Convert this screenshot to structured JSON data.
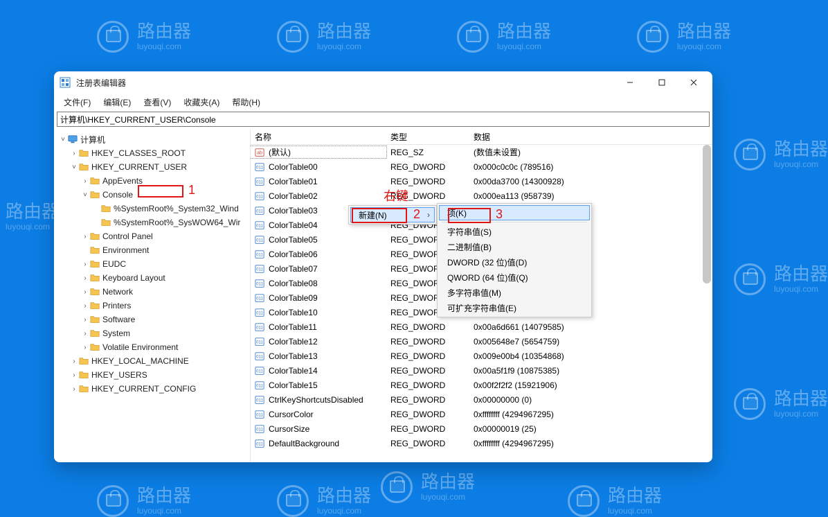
{
  "watermark": {
    "main": "路由器",
    "sub": "luyouqi.com"
  },
  "window": {
    "title": "注册表编辑器",
    "address": "计算机\\HKEY_CURRENT_USER\\Console"
  },
  "menu": {
    "file": "文件(F)",
    "edit": "编辑(E)",
    "view": "查看(V)",
    "favorites": "收藏夹(A)",
    "help": "帮助(H)"
  },
  "tree": {
    "root": "计算机",
    "hkcr": "HKEY_CLASSES_ROOT",
    "hkcu": "HKEY_CURRENT_USER",
    "appevents": "AppEvents",
    "console": "Console",
    "consolechild1": "%SystemRoot%_System32_Wind",
    "consolechild2": "%SystemRoot%_SysWOW64_Wir",
    "controlpanel": "Control Panel",
    "environment": "Environment",
    "eudc": "EUDC",
    "keyboard": "Keyboard Layout",
    "network": "Network",
    "printers": "Printers",
    "software": "Software",
    "system": "System",
    "volatile": "Volatile Environment",
    "hklm": "HKEY_LOCAL_MACHINE",
    "hku": "HKEY_USERS",
    "hkcc": "HKEY_CURRENT_CONFIG"
  },
  "columns": {
    "name": "名称",
    "type": "类型",
    "data": "数据"
  },
  "values": [
    {
      "icon": "str",
      "name": "(默认)",
      "type": "REG_SZ",
      "data": "(数值未设置)"
    },
    {
      "icon": "bin",
      "name": "ColorTable00",
      "type": "REG_DWORD",
      "data": "0x000c0c0c (789516)"
    },
    {
      "icon": "bin",
      "name": "ColorTable01",
      "type": "REG_DWORD",
      "data": "0x00da3700 (14300928)"
    },
    {
      "icon": "bin",
      "name": "ColorTable02",
      "type": "REG_DWORD",
      "data": "0x000ea113 (958739)"
    },
    {
      "icon": "bin",
      "name": "ColorTable03",
      "type": "REG_DWORD",
      "data": ""
    },
    {
      "icon": "bin",
      "name": "ColorTable04",
      "type": "REG_DWORD",
      "data": ""
    },
    {
      "icon": "bin",
      "name": "ColorTable05",
      "type": "REG_DWORD",
      "data": ""
    },
    {
      "icon": "bin",
      "name": "ColorTable06",
      "type": "REG_DWORD",
      "data": ""
    },
    {
      "icon": "bin",
      "name": "ColorTable07",
      "type": "REG_DWORD",
      "data": ""
    },
    {
      "icon": "bin",
      "name": "ColorTable08",
      "type": "REG_DWORD",
      "data": ""
    },
    {
      "icon": "bin",
      "name": "ColorTable09",
      "type": "REG_DWORD",
      "data": ""
    },
    {
      "icon": "bin",
      "name": "ColorTable10",
      "type": "REG_DWORD",
      "data": ""
    },
    {
      "icon": "bin",
      "name": "ColorTable11",
      "type": "REG_DWORD",
      "data": "0x00a6d661 (14079585)"
    },
    {
      "icon": "bin",
      "name": "ColorTable12",
      "type": "REG_DWORD",
      "data": "0x005648e7 (5654759)"
    },
    {
      "icon": "bin",
      "name": "ColorTable13",
      "type": "REG_DWORD",
      "data": "0x009e00b4 (10354868)"
    },
    {
      "icon": "bin",
      "name": "ColorTable14",
      "type": "REG_DWORD",
      "data": "0x00a5f1f9 (10875385)"
    },
    {
      "icon": "bin",
      "name": "ColorTable15",
      "type": "REG_DWORD",
      "data": "0x00f2f2f2 (15921906)"
    },
    {
      "icon": "bin",
      "name": "CtrlKeyShortcutsDisabled",
      "type": "REG_DWORD",
      "data": "0x00000000 (0)"
    },
    {
      "icon": "bin",
      "name": "CursorColor",
      "type": "REG_DWORD",
      "data": "0xffffffff (4294967295)"
    },
    {
      "icon": "bin",
      "name": "CursorSize",
      "type": "REG_DWORD",
      "data": "0x00000019 (25)"
    },
    {
      "icon": "bin",
      "name": "DefaultBackground",
      "type": "REG_DWORD",
      "data": "0xffffffff (4294967295)"
    }
  ],
  "contextmenu": {
    "new": "新建(N)"
  },
  "submenu": {
    "key": "项(K)",
    "string": "字符串值(S)",
    "binary": "二进制值(B)",
    "dword": "DWORD (32 位)值(D)",
    "qword": "QWORD (64 位)值(Q)",
    "multi": "多字符串值(M)",
    "expand": "可扩充字符串值(E)"
  },
  "annotations": {
    "rightclick": "右键",
    "n1": "1",
    "n2": "2",
    "n3": "3"
  }
}
